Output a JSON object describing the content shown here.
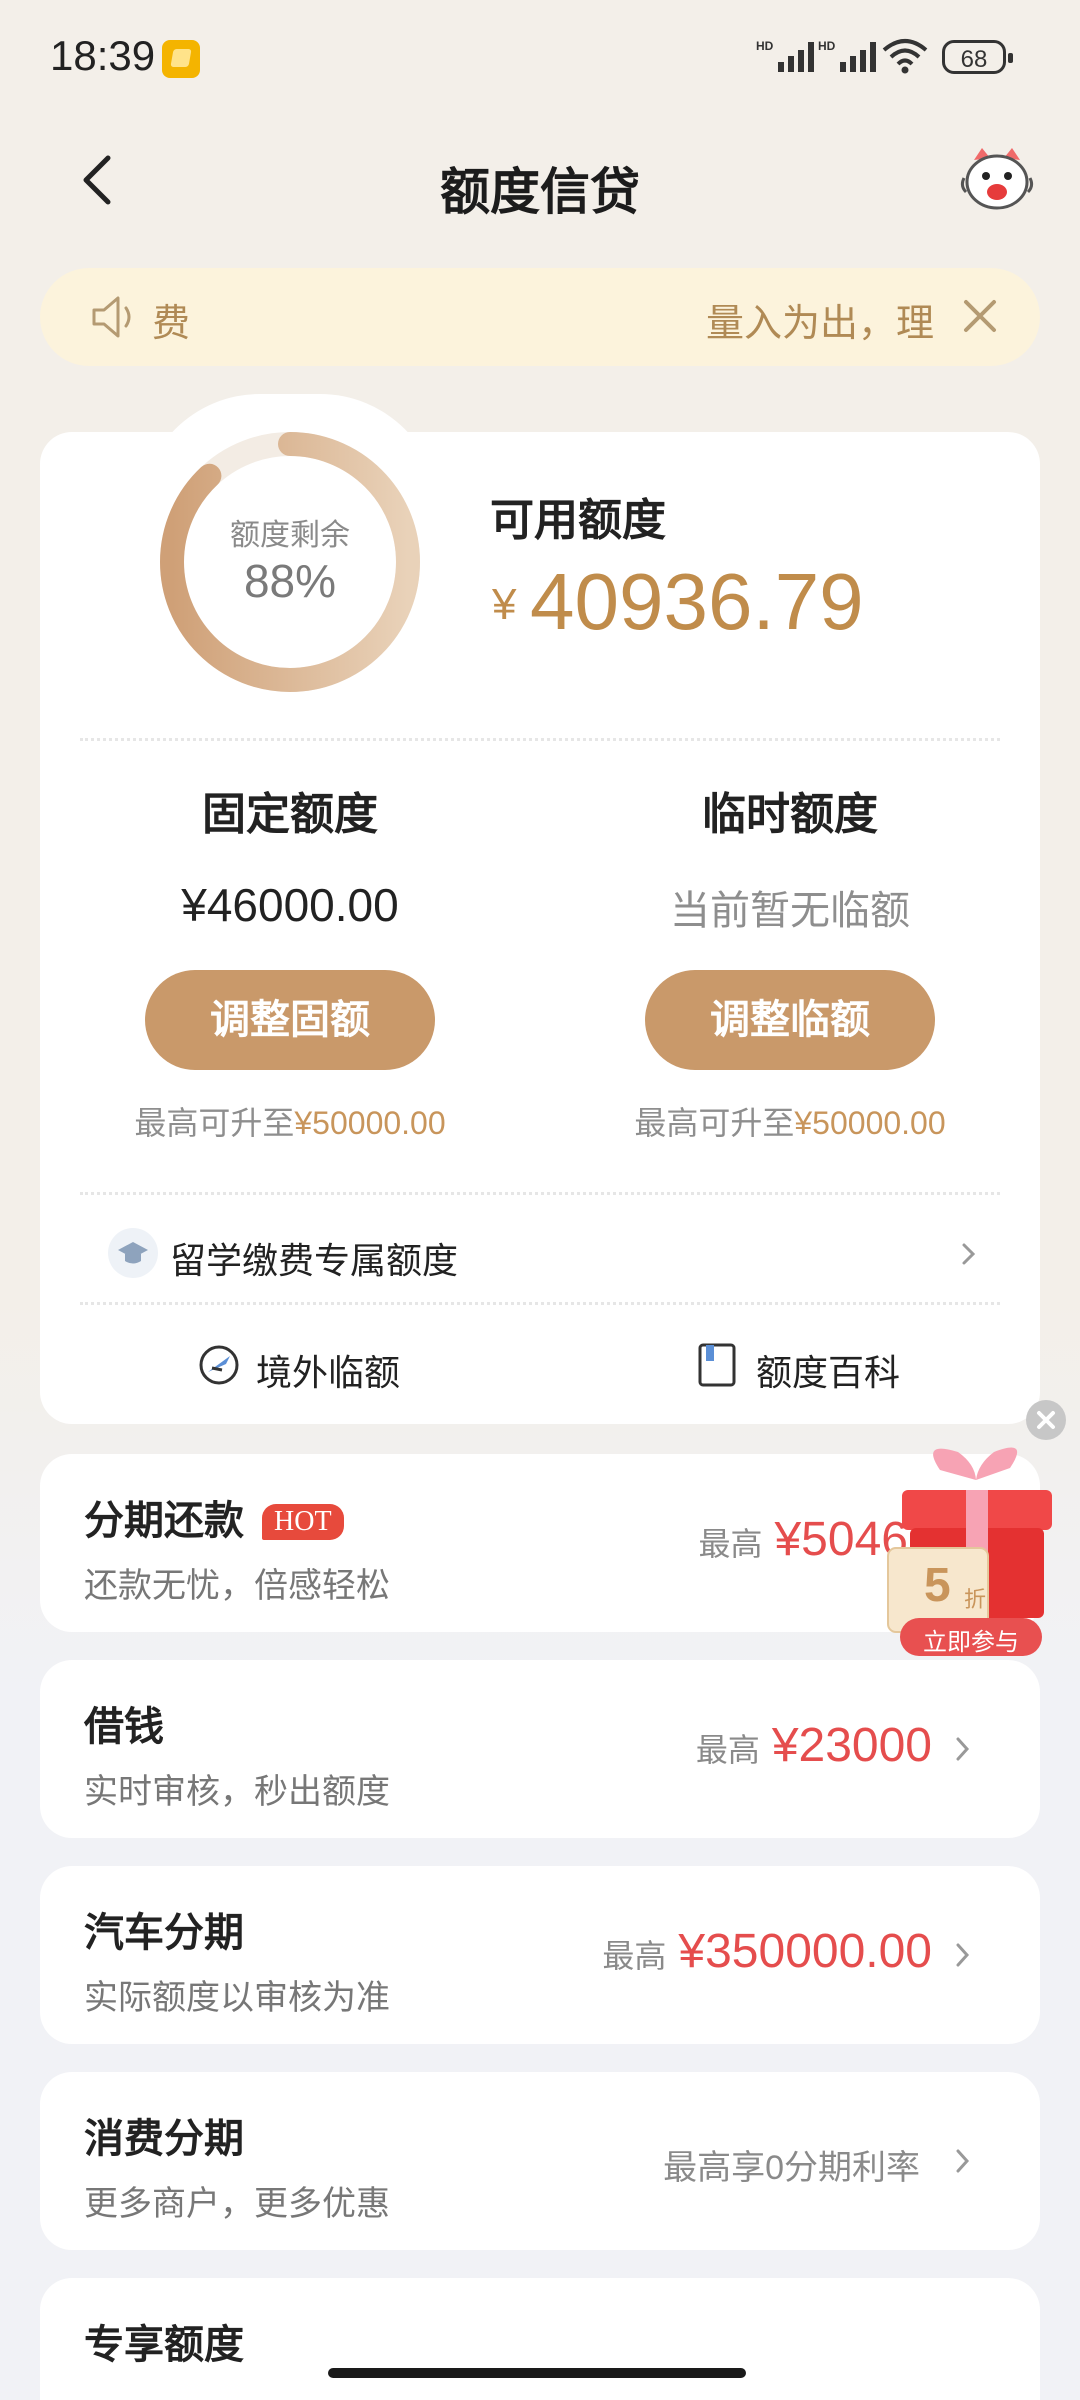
{
  "status_bar": {
    "time": "18:39",
    "battery": "68",
    "signal_labels": [
      "HD",
      "HD"
    ]
  },
  "nav": {
    "title": "额度信贷"
  },
  "notice": {
    "left_text": "费",
    "right_text": "量入为出，理"
  },
  "credit": {
    "ring_label": "额度剩余",
    "ring_percent": "88%",
    "ring_fraction": 0.88,
    "available_label": "可用额度",
    "currency": "¥",
    "available_amount": "40936.79",
    "fixed": {
      "title": "固定额度",
      "amount": "¥46000.00",
      "button": "调整固额",
      "max_prefix": "最高可升至",
      "max_value": "¥50000.00"
    },
    "temp": {
      "title": "临时额度",
      "amount": "当前暂无临额",
      "button": "调整临额",
      "max_prefix": "最高可升至",
      "max_value": "¥50000.00"
    },
    "study_row": "留学缴费专属额度",
    "tools": [
      {
        "label": "境外临额",
        "icon": "plane-icon"
      },
      {
        "label": "额度百科",
        "icon": "book-icon"
      }
    ]
  },
  "services": [
    {
      "name": "分期还款",
      "badge": "HOT",
      "desc": "还款无忧，倍感轻松",
      "prefix": "最高",
      "value": "¥5046.0"
    },
    {
      "name": "借钱",
      "desc": "实时审核，秒出额度",
      "prefix": "最高",
      "value": "¥23000"
    },
    {
      "name": "汽车分期",
      "desc": "实际额度以审核为准",
      "prefix": "最高",
      "value": "¥350000.00"
    },
    {
      "name": "消费分期",
      "desc": "更多商户，更多优惠",
      "prefix": "最高享0分期利率",
      "value": ""
    },
    {
      "name": "专享额度",
      "desc": "",
      "prefix": "",
      "value": ""
    }
  ],
  "promo": {
    "discount": "5",
    "discount_unit": "折",
    "cta": "立即参与"
  },
  "colors": {
    "accent_gold": "#c9996a",
    "price_red": "#e54d4d",
    "hot_red": "#e74a3c",
    "notice_bg": "#fcf3dc"
  }
}
